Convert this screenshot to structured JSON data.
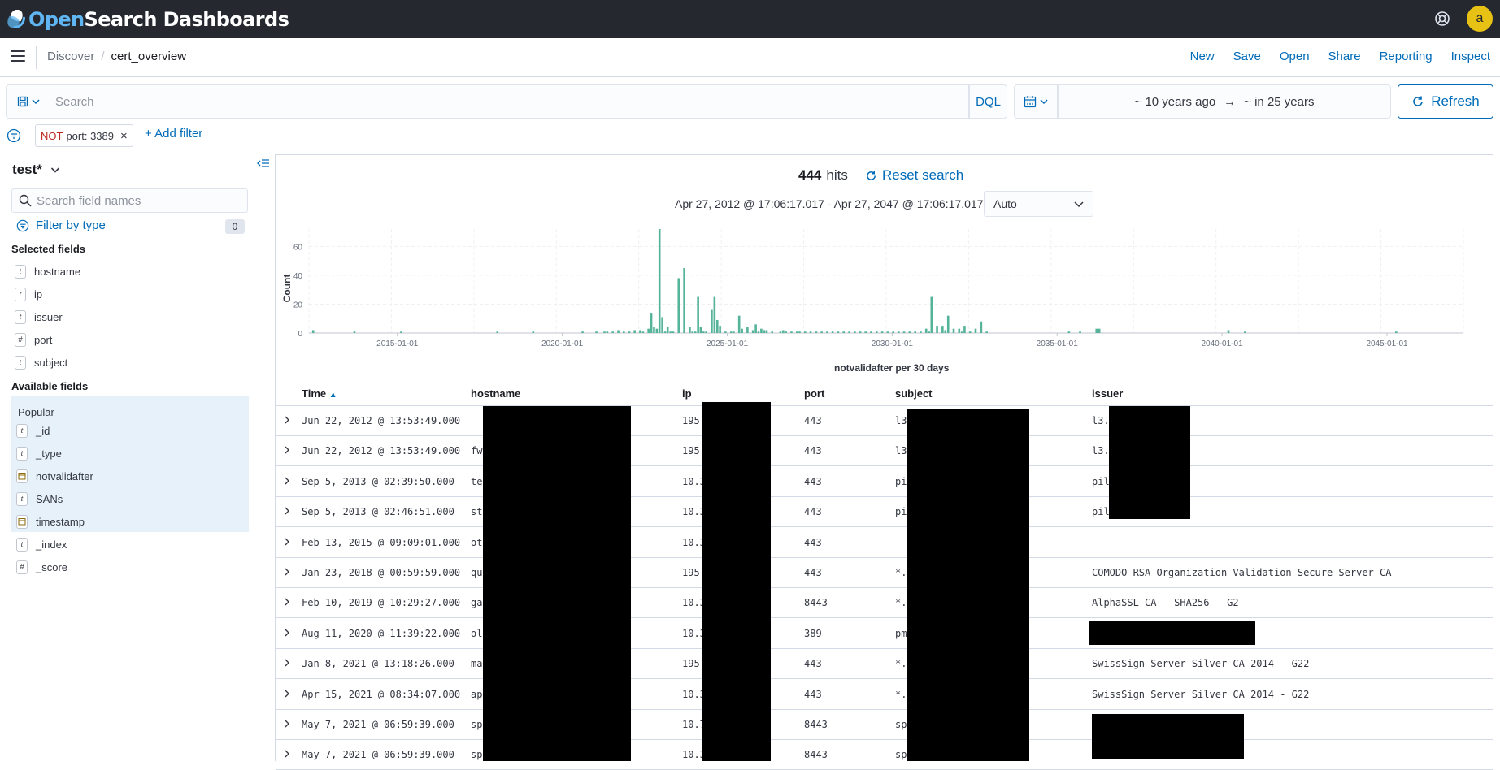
{
  "app": {
    "logo_open": "Open",
    "logo_rest": "Search Dashboards",
    "avatar_initial": "a"
  },
  "breadcrumb": {
    "first": "Discover",
    "separator": "/",
    "current": "cert_overview"
  },
  "topnav": [
    "New",
    "Save",
    "Open",
    "Share",
    "Reporting",
    "Inspect"
  ],
  "query": {
    "placeholder": "Search",
    "language": "DQL"
  },
  "time": {
    "start": "~ 10 years ago",
    "arrow": "→",
    "end": "~ in 25 years",
    "refresh_label": "Refresh"
  },
  "filters": {
    "pill_not": "NOT",
    "pill_text": "port: 3389",
    "add_label": "+ Add filter"
  },
  "sidebar": {
    "index_pattern": "test*",
    "field_search_placeholder": "Search field names",
    "filter_by_type": "Filter by type",
    "filter_count": "0",
    "selected_heading": "Selected fields",
    "selected": [
      {
        "type": "t",
        "name": "hostname"
      },
      {
        "type": "t",
        "name": "ip"
      },
      {
        "type": "t",
        "name": "issuer"
      },
      {
        "type": "#",
        "name": "port"
      },
      {
        "type": "t",
        "name": "subject"
      }
    ],
    "available_heading": "Available fields",
    "popular_heading": "Popular",
    "popular": [
      {
        "type": "t",
        "name": "_id"
      },
      {
        "type": "t",
        "name": "_type"
      },
      {
        "type": "date",
        "name": "notvalidafter"
      },
      {
        "type": "t",
        "name": "SANs"
      },
      {
        "type": "date",
        "name": "timestamp"
      }
    ],
    "other": [
      {
        "type": "t",
        "name": "_index"
      },
      {
        "type": "#",
        "name": "_score"
      }
    ]
  },
  "results": {
    "hits_count": "444",
    "hits_label": "hits",
    "reset_label": "Reset search",
    "range_text": "Apr 27, 2012 @ 17:06:17.017 - Apr 27, 2047 @ 17:06:17.017",
    "interval": "Auto"
  },
  "chart_data": {
    "type": "bar",
    "xlabel": "notvalidafter per 30 days",
    "ylabel": "Count",
    "ylim": [
      0,
      72
    ],
    "yticks": [
      0,
      20,
      40,
      60
    ],
    "xticks": [
      "2015-01-01",
      "2020-01-01",
      "2025-01-01",
      "2030-01-01",
      "2035-01-01",
      "2040-01-01",
      "2045-01-01"
    ],
    "xrange": [
      "2012-04-27",
      "2047-04-27"
    ],
    "color": "#54b399",
    "x": [
      "2012-06",
      "2013-09",
      "2015-02",
      "2018-01",
      "2019-02",
      "2020-08",
      "2021-01",
      "2021-04",
      "2021-05",
      "2021-07",
      "2021-09",
      "2021-11",
      "2022-01",
      "2022-03",
      "2022-05",
      "2022-06",
      "2022-08",
      "2022-09",
      "2022-10",
      "2022-11",
      "2022-12",
      "2023-01",
      "2023-02",
      "2023-03",
      "2023-04",
      "2023-05",
      "2023-07",
      "2023-09",
      "2023-11",
      "2023-12",
      "2024-01",
      "2024-02",
      "2024-03",
      "2024-04",
      "2024-05",
      "2024-07",
      "2024-08",
      "2024-09",
      "2024-10",
      "2024-12",
      "2025-02",
      "2025-03",
      "2025-05",
      "2025-06",
      "2025-08",
      "2025-10",
      "2025-11",
      "2025-12",
      "2026-01",
      "2026-02",
      "2026-03",
      "2026-05",
      "2026-08",
      "2026-09",
      "2026-10",
      "2026-12",
      "2027-02",
      "2027-03",
      "2027-05",
      "2027-07",
      "2027-09",
      "2027-11",
      "2028-01",
      "2028-03",
      "2028-05",
      "2028-07",
      "2028-09",
      "2028-11",
      "2029-01",
      "2029-03",
      "2029-05",
      "2029-07",
      "2029-09",
      "2029-11",
      "2030-01",
      "2030-03",
      "2030-05",
      "2030-07",
      "2030-09",
      "2030-11",
      "2031-01",
      "2031-02",
      "2031-03",
      "2031-05",
      "2031-07",
      "2031-08",
      "2031-09",
      "2031-11",
      "2032-01",
      "2032-02",
      "2032-03",
      "2032-05",
      "2032-07",
      "2032-09",
      "2032-11",
      "2035-05",
      "2035-09",
      "2036-03",
      "2036-04",
      "2040-03",
      "2040-09",
      "2045-04"
    ],
    "values": [
      2,
      1,
      1,
      1,
      1,
      1,
      1,
      1,
      1,
      1,
      2,
      1,
      1,
      2,
      2,
      1,
      3,
      14,
      4,
      3,
      72,
      11,
      1,
      4,
      1,
      1,
      38,
      45,
      4,
      1,
      1,
      25,
      4,
      1,
      1,
      16,
      25,
      9,
      5,
      1,
      1,
      1,
      12,
      3,
      4,
      2,
      6,
      1,
      3,
      2,
      2,
      1,
      1,
      2,
      1,
      1,
      1,
      1,
      1,
      1,
      1,
      1,
      1,
      1,
      1,
      1,
      1,
      1,
      1,
      1,
      1,
      1,
      1,
      1,
      1,
      1,
      1,
      1,
      1,
      1,
      3,
      1,
      25,
      5,
      5,
      2,
      12,
      3,
      3,
      1,
      5,
      1,
      3,
      8,
      1,
      1,
      1,
      3,
      3,
      2,
      1,
      1,
      2
    ]
  },
  "table": {
    "columns": [
      "Time",
      "hostname",
      "ip",
      "port",
      "subject",
      "issuer"
    ],
    "rows": [
      {
        "time": "Jun 22, 2012 @ 13:53:49.000",
        "hostname": "",
        "ip": "195",
        "port": "443",
        "subject": "l3",
        "issuer": "l3."
      },
      {
        "time": "Jun 22, 2012 @ 13:53:49.000",
        "hostname": "fw",
        "ip": "195",
        "port": "443",
        "subject": "l3",
        "issuer": "l3."
      },
      {
        "time": "Sep 5, 2013 @ 02:39:50.000",
        "hostname": "te",
        "ip": "10.3",
        "port": "443",
        "subject": "pi",
        "issuer": "pil"
      },
      {
        "time": "Sep 5, 2013 @ 02:46:51.000",
        "hostname": "st",
        "ip": "10.3",
        "port": "443",
        "subject": "pi",
        "issuer": "pil"
      },
      {
        "time": "Feb 13, 2015 @ 09:09:01.000",
        "hostname": "ot",
        "ip": "10.3",
        "port": "443",
        "subject": " -",
        "issuer": " -"
      },
      {
        "time": "Jan 23, 2018 @ 00:59:59.000",
        "hostname": "qu",
        "ip": "195",
        "port": "443",
        "subject": "*.",
        "issuer": "COMODO RSA Organization Validation Secure Server CA"
      },
      {
        "time": "Feb 10, 2019 @ 10:29:27.000",
        "hostname": "ga",
        "ip": "10.3",
        "port": "8443",
        "subject": "*.",
        "issuer": "AlphaSSL CA - SHA256 - G2"
      },
      {
        "time": "Aug 11, 2020 @ 11:39:22.000",
        "hostname": "ol",
        "ip": "10.3",
        "port": "389",
        "subject": "pm",
        "issuer": ""
      },
      {
        "time": "Jan 8, 2021 @ 13:18:26.000",
        "hostname": "ma",
        "ip": "195",
        "port": "443",
        "subject": "*.",
        "issuer": "SwissSign Server Silver CA 2014 - G22"
      },
      {
        "time": "Apr 15, 2021 @ 08:34:07.000",
        "hostname": "ap",
        "ip": "10.3",
        "port": "443",
        "subject": "*.",
        "issuer": "SwissSign Server Silver CA 2014 - G22"
      },
      {
        "time": "May 7, 2021 @ 06:59:39.000",
        "hostname": "sp",
        "ip": "10.7",
        "port": "8443",
        "subject": "sp",
        "issuer": ""
      },
      {
        "time": "May 7, 2021 @ 06:59:39.000",
        "hostname": "sp",
        "ip": "10.3",
        "port": "8443",
        "subject": "sp",
        "issuer": ""
      }
    ]
  }
}
